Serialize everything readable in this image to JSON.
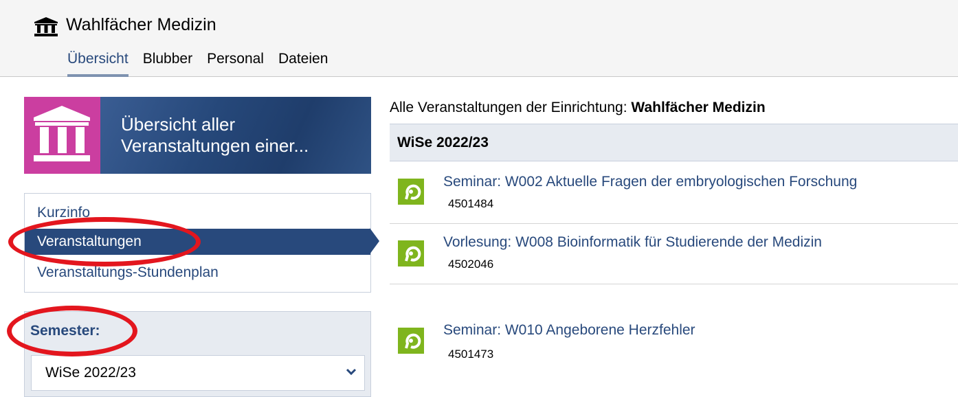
{
  "header": {
    "institution_icon": "building-columns-icon",
    "title": "Wahlfächer Medizin",
    "tabs": [
      {
        "label": "Übersicht",
        "active": true
      },
      {
        "label": "Blubber",
        "active": false
      },
      {
        "label": "Personal",
        "active": false
      },
      {
        "label": "Dateien",
        "active": false
      }
    ]
  },
  "sidebar": {
    "banner": {
      "icon": "building-columns-icon",
      "text": "Übersicht aller Veranstaltungen einer..."
    },
    "nav": {
      "items": [
        {
          "label": "Kurzinfo",
          "active": false
        },
        {
          "label": "Veranstaltungen",
          "active": true
        },
        {
          "label": "Veranstaltungs-Stundenplan",
          "active": false
        }
      ]
    },
    "semester_widget": {
      "heading": "Semester:",
      "selected": "WiSe 2022/23"
    }
  },
  "main": {
    "title_prefix": "Alle Veranstaltungen der Einrichtung: ",
    "title_institution": "Wahlfächer Medizin",
    "semester_label": "WiSe 2022/23",
    "courses": [
      {
        "title": "Seminar: W002 Aktuelle Fragen der embryologischen Forschung",
        "number": "4501484",
        "icon": "course-icon"
      },
      {
        "title": "Vorlesung: W008 Bioinformatik für Studierende der Medizin",
        "number": "4502046",
        "icon": "course-icon"
      },
      {
        "title": "Seminar: W010 Angeborene Herzfehler",
        "number": "4501473",
        "icon": "course-icon"
      }
    ]
  },
  "colors": {
    "accent": "#28497c",
    "banner_icon_bg": "#cb3ea0",
    "course_icon_bg": "#7fb51d",
    "highlight_ring": "#e3161e"
  }
}
